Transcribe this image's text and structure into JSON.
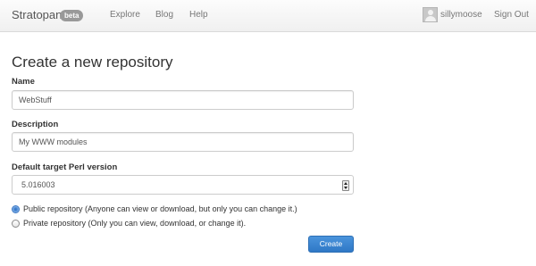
{
  "navbar": {
    "brand": "Stratopan",
    "badge": "beta",
    "links": [
      "Explore",
      "Blog",
      "Help"
    ],
    "username": "sillymoose",
    "signout": "Sign Out"
  },
  "form": {
    "title": "Create a new repository",
    "name_label": "Name",
    "name_value": "WebStuff",
    "description_label": "Description",
    "description_value": "My WWW modules",
    "perl_label": "Default target Perl version",
    "perl_value": "5.016003",
    "radio_public": "Public repository (Anyone can view or download, but only you can change it.)",
    "radio_private": "Private repository (Only you can view, download, or change it).",
    "public_selected": true,
    "create_button": "Create"
  },
  "colors": {
    "accent": "#3a82cd",
    "navbar_bg": "#f5f5f5"
  }
}
